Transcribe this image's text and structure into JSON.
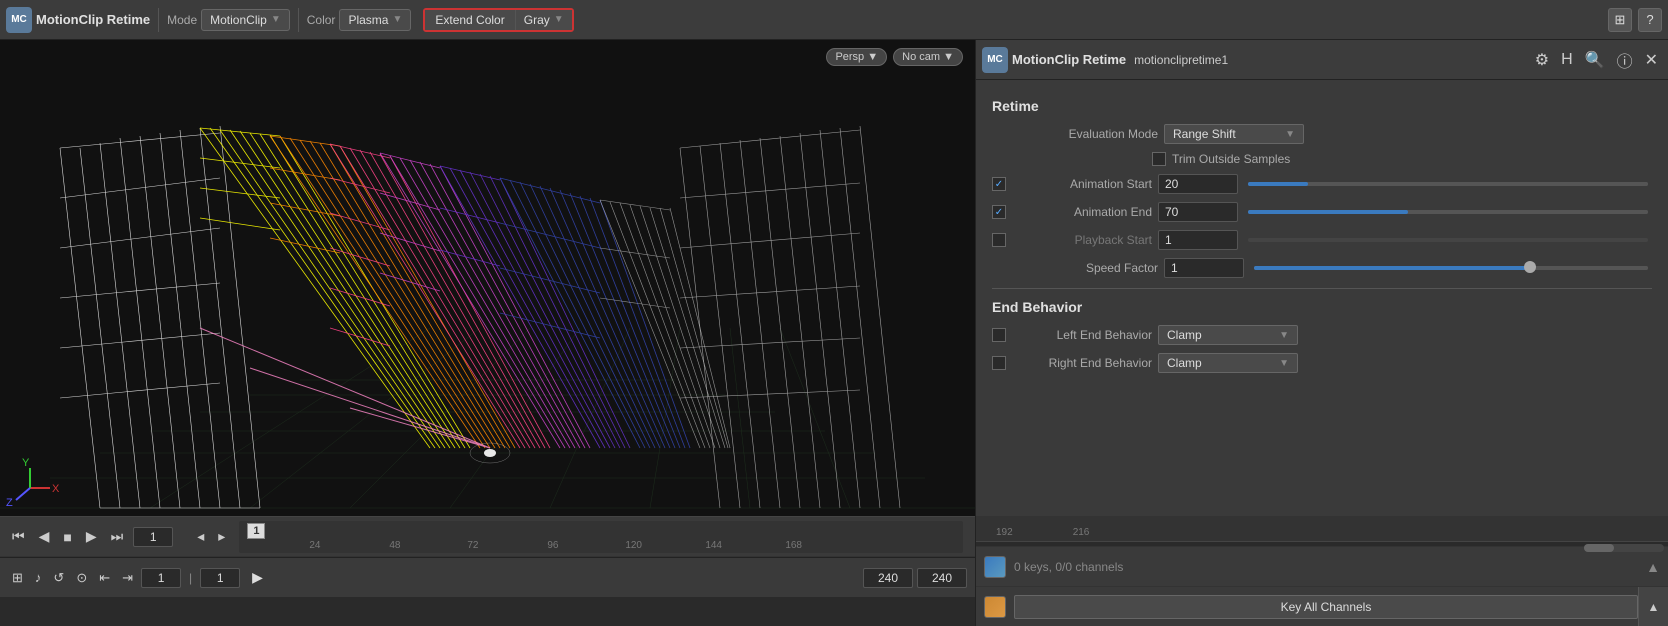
{
  "app": {
    "title": "MotionClip Retime",
    "mode_label": "Mode",
    "mode_value": "MotionClip",
    "color_label": "Color",
    "color_value": "Plasma",
    "extend_color_label": "Extend Color",
    "extend_color_value": "Gray"
  },
  "right_panel": {
    "title": "MotionClip Retime",
    "node_name": "motionclipretime1",
    "section_retime": "Retime",
    "eval_mode_label": "Evaluation Mode",
    "eval_mode_value": "Range Shift",
    "trim_label": "Trim Outside Samples",
    "anim_start_label": "Animation Start",
    "anim_start_value": "20",
    "anim_end_label": "Animation End",
    "anim_end_value": "70",
    "playback_start_label": "Playback Start",
    "playback_start_value": "1",
    "speed_factor_label": "Speed Factor",
    "speed_factor_value": "1",
    "section_end_behavior": "End Behavior",
    "left_end_label": "Left End Behavior",
    "left_end_value": "Clamp",
    "right_end_label": "Right End Behavior",
    "right_end_value": "Clamp"
  },
  "viewport": {
    "persp_label": "Persp",
    "no_cam_label": "No cam"
  },
  "transport": {
    "frame_start": "1",
    "frame_current": "1",
    "frame_end_1": "240",
    "frame_end_2": "240"
  },
  "timeline": {
    "markers": [
      "1",
      "24",
      "48",
      "72",
      "96",
      "120",
      "144",
      "168",
      "192",
      "216"
    ],
    "current_frame": "1"
  },
  "bottom_right": {
    "keys_status": "0 keys, 0/0 channels",
    "key_all_label": "Key All Channels"
  }
}
